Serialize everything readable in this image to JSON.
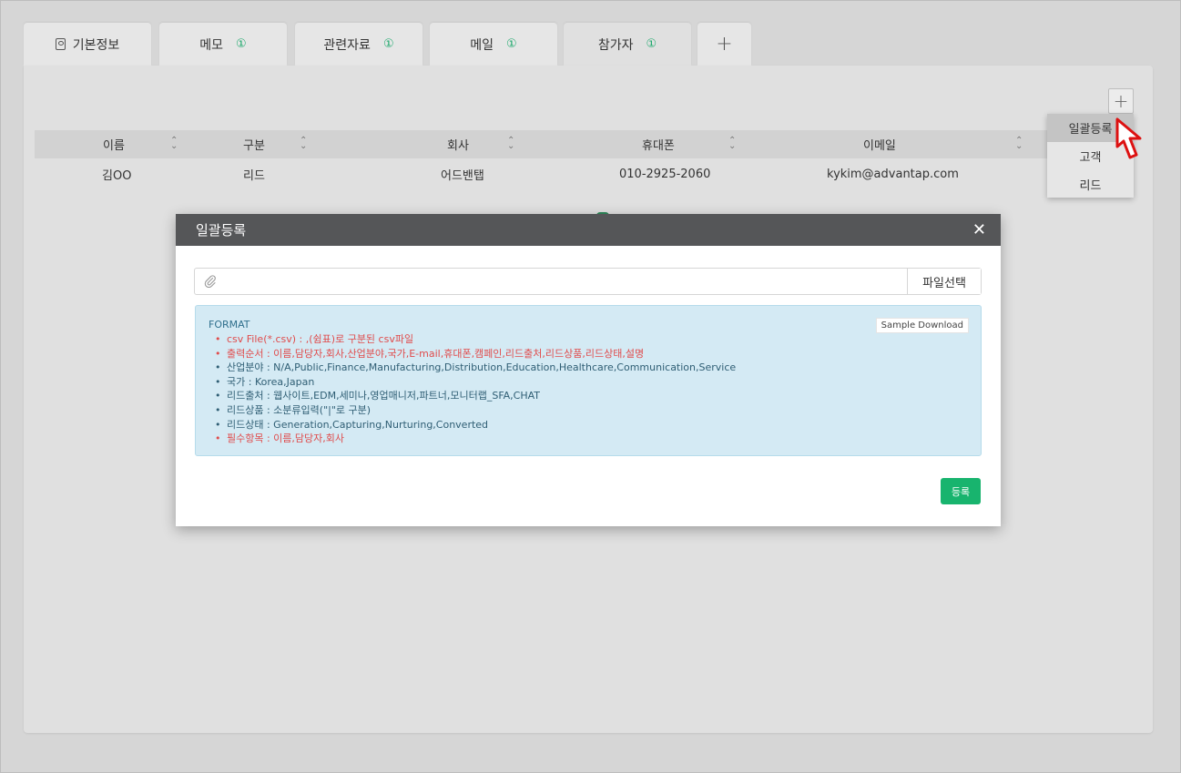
{
  "tabs": [
    {
      "label": "기본정보",
      "badge": ""
    },
    {
      "label": "메모",
      "badge": "①"
    },
    {
      "label": "관련자료",
      "badge": "①"
    },
    {
      "label": "메일",
      "badge": "①"
    },
    {
      "label": "참가자",
      "badge": "①"
    },
    {
      "label": "+",
      "badge": ""
    }
  ],
  "panel": {
    "add_label": "+",
    "columns": [
      "이름",
      "구분",
      "회사",
      "휴대폰",
      "이메일"
    ],
    "row": {
      "name": "김OO",
      "type": "리드",
      "company": "어드밴탭",
      "phone": "010-2925-2060",
      "email": "kykim@advantap.com"
    }
  },
  "dropdown": {
    "items": [
      "일괄등록",
      "고객",
      "리드"
    ]
  },
  "modal": {
    "title": "일괄등록",
    "close": "✕",
    "file_input_value": "",
    "file_button": "파일선택",
    "format_title": "FORMAT",
    "sample_download": "Sample Download",
    "lines": [
      {
        "text": "csv File(*.csv) : ,(쉼표)로 구분된 csv파일",
        "color": "red"
      },
      {
        "text": "출력순서 : 이름,담당자,회사,산업분야,국가,E-mail,휴대폰,캠페인,리드출처,리드상품,리드상태,설명",
        "color": "red"
      },
      {
        "text": "산업분야 : N/A,Public,Finance,Manufacturing,Distribution,Education,Healthcare,Communication,Service",
        "color": "blue"
      },
      {
        "text": "국가 : Korea,Japan",
        "color": "blue"
      },
      {
        "text": "리드출처 : 웹사이트,EDM,세미나,영업매니저,파트너,모니터랩_SFA,CHAT",
        "color": "blue"
      },
      {
        "text": "리드상품 : 소분류입력(\"|\"로 구분)",
        "color": "blue"
      },
      {
        "text": "리드상태 : Generation,Capturing,Nurturing,Converted",
        "color": "blue"
      },
      {
        "text": "필수항목 : 이름,담당자,회사",
        "color": "red"
      }
    ],
    "submit": "등록"
  },
  "colors": {
    "accent": "#18b46e",
    "badge": "#1aa86b",
    "red_text": "#e04b4b",
    "info_bg": "#d4eaf4",
    "header_bg": "#555658"
  }
}
